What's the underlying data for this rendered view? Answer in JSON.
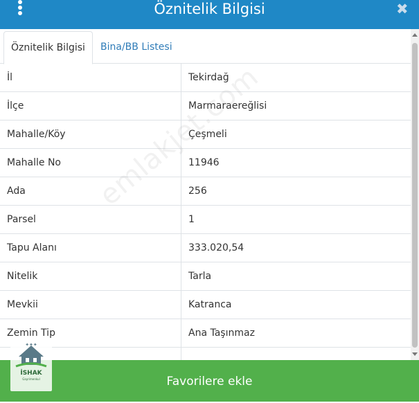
{
  "header": {
    "title": "Öznitelik Bilgisi",
    "menu_icon": "kebab-menu-icon",
    "close_icon": "close-icon",
    "close_glyph": "✖"
  },
  "tabs": [
    {
      "label": "Öznitelik Bilgisi",
      "active": true
    },
    {
      "label": "Bina/BB Listesi",
      "active": false
    }
  ],
  "rows": [
    {
      "key": "İl",
      "value": "Tekirdağ"
    },
    {
      "key": "İlçe",
      "value": "Marmaraereğlisi"
    },
    {
      "key": "Mahalle/Köy",
      "value": "Çeşmeli"
    },
    {
      "key": "Mahalle No",
      "value": "11946"
    },
    {
      "key": "Ada",
      "value": "256"
    },
    {
      "key": "Parsel",
      "value": "1"
    },
    {
      "key": "Tapu Alanı",
      "value": "333.020,54"
    },
    {
      "key": "Nitelik",
      "value": "Tarla"
    },
    {
      "key": "Mevkii",
      "value": "Katranca"
    },
    {
      "key": "Zemin Tip",
      "value": "Ana Taşınmaz"
    },
    {
      "key": "",
      "value": ""
    }
  ],
  "footer": {
    "button_label": "Favorilere ekle"
  },
  "logo": {
    "name": "İSHAK",
    "tagline": "Gayrimenkul"
  },
  "watermark": "emlakjet.com",
  "colors": {
    "header": "#1f88c6",
    "tab_link": "#2f7cb8",
    "footer": "#52b04b"
  }
}
